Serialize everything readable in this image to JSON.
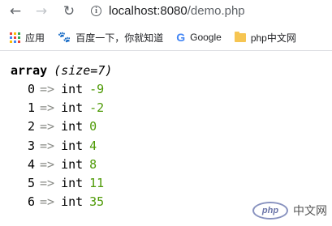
{
  "browser": {
    "url_host": "localhost:8080",
    "url_path": "/demo.php",
    "icons": {
      "back": "arrow-left",
      "forward": "arrow-right",
      "reload": "reload",
      "site_info": "info-circle"
    }
  },
  "bookmarks": [
    {
      "label": "应用",
      "icon": "apps-grid-icon"
    },
    {
      "label": "百度一下，你就知道",
      "icon": "baidu-paw-icon"
    },
    {
      "label": "Google",
      "icon": "google-g-icon"
    },
    {
      "label": "php中文网",
      "icon": "folder-icon"
    }
  ],
  "dump": {
    "type": "array",
    "size_label": "(size=7)",
    "arrow": "=>",
    "entries": [
      {
        "index": "0",
        "type": "int",
        "value": "-9"
      },
      {
        "index": "1",
        "type": "int",
        "value": "-2"
      },
      {
        "index": "2",
        "type": "int",
        "value": "0"
      },
      {
        "index": "3",
        "type": "int",
        "value": "4"
      },
      {
        "index": "4",
        "type": "int",
        "value": "8"
      },
      {
        "index": "5",
        "type": "int",
        "value": "11"
      },
      {
        "index": "6",
        "type": "int",
        "value": "35"
      }
    ]
  },
  "watermark": {
    "logo_text": "php",
    "text": "中文网"
  },
  "colors": {
    "value_green": "#4e9a06",
    "arrow_gray": "#888a85",
    "apps_colors": [
      "#ea4335",
      "#fbbc05",
      "#34a853",
      "#4285f4",
      "#ea4335",
      "#34a853",
      "#fbbc05",
      "#4285f4",
      "#ea4335"
    ]
  }
}
